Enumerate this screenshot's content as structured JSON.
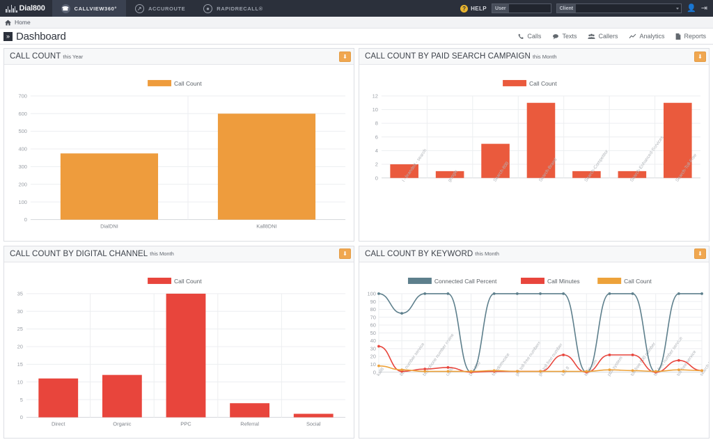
{
  "topnav": {
    "brand": "Dial800",
    "brand_sup": "®",
    "products": [
      {
        "label": "CALLVIEW360°",
        "icon": "phone-circle-icon",
        "active": true
      },
      {
        "label": "ACCUROUTE",
        "icon": "route-circle-icon",
        "active": false
      },
      {
        "label": "RAPIDRECALL®",
        "icon": "bulb-circle-icon",
        "active": false
      }
    ],
    "help_label": "HELP",
    "help_badge": "?",
    "user_field": {
      "label": "User",
      "value": "",
      "placeholder": ""
    },
    "client_field": {
      "label": "Client",
      "value": "",
      "placeholder": ""
    },
    "account_icon": "user-icon",
    "logout_icon": "logout-icon"
  },
  "breadcrumb": {
    "home": "Home",
    "icon": "home-icon"
  },
  "page": {
    "title": "Dashboard",
    "chevron": "»",
    "tabs": [
      {
        "label": "Calls",
        "icon": "phone-icon"
      },
      {
        "label": "Texts",
        "icon": "chat-icon"
      },
      {
        "label": "Callers",
        "icon": "people-icon"
      },
      {
        "label": "Analytics",
        "icon": "chart-line-icon"
      },
      {
        "label": "Reports",
        "icon": "document-icon"
      }
    ]
  },
  "colors": {
    "orange": "#ee9c3d",
    "red": "#e8453c",
    "red_orange": "#ea5a3d",
    "teal": "#5d7f8c",
    "dark": "#2b303b",
    "download": "#f0a750"
  },
  "panels": [
    {
      "title": "CALL COUNT",
      "subtitle": "this Year",
      "download_icon": "download-icon"
    },
    {
      "title": "CALL COUNT BY PAID SEARCH CAMPAIGN",
      "subtitle": "this Month",
      "download_icon": "download-icon"
    },
    {
      "title": "CALL COUNT BY DIGITAL CHANNEL",
      "subtitle": "this Month",
      "download_icon": "download-icon"
    },
    {
      "title": "CALL COUNT BY KEYWORD",
      "subtitle": "this Month",
      "download_icon": "download-icon"
    }
  ],
  "chart_data": [
    {
      "type": "bar",
      "title": "CALL COUNT this Year",
      "categories": [
        "DialDNI",
        "Kall8DNI"
      ],
      "values": [
        375,
        600
      ],
      "series": [
        {
          "name": "Call Count",
          "values": [
            375,
            600
          ],
          "color": "#ee9c3d"
        }
      ],
      "legend": [
        "Call Count"
      ],
      "legend_position": "top",
      "yticks": [
        0,
        100,
        200,
        300,
        400,
        500,
        600,
        700
      ],
      "ylim": [
        0,
        700
      ],
      "xlabel": "",
      "ylabel": "",
      "grid": true
    },
    {
      "type": "bar",
      "title": "CALL COUNT BY PAID SEARCH CAMPAIGN this Month",
      "categories": [
        "l - branded - search",
        "google",
        "Search-800",
        "Search-Brand",
        "Search-Competitor",
        "Search-Enhanced-Services",
        "Search-Toll-Free"
      ],
      "values": [
        2,
        1,
        5,
        11,
        1,
        1,
        11
      ],
      "series": [
        {
          "name": "Call Count",
          "values": [
            2,
            1,
            5,
            11,
            1,
            1,
            11
          ],
          "color": "#ea5a3d"
        }
      ],
      "legend": [
        "Call Count"
      ],
      "legend_position": "top",
      "yticks": [
        0,
        2,
        4,
        6,
        8,
        10,
        12
      ],
      "ylim": [
        0,
        12
      ],
      "xlabel": "",
      "ylabel": "",
      "grid": true
    },
    {
      "type": "bar",
      "title": "CALL COUNT BY DIGITAL CHANNEL this Month",
      "categories": [
        "Direct",
        "Organic",
        "PPC",
        "Referral",
        "Social"
      ],
      "values": [
        11,
        12,
        35,
        4,
        1
      ],
      "series": [
        {
          "name": "Call Count",
          "values": [
            11,
            12,
            35,
            4,
            1
          ],
          "color": "#e8453c"
        }
      ],
      "legend": [
        "Call Count"
      ],
      "legend_position": "top",
      "yticks": [
        0,
        5,
        10,
        15,
        20,
        25,
        30,
        35
      ],
      "ylim": [
        0,
        35
      ],
      "xlabel": "",
      "ylabel": "",
      "grid": true
    },
    {
      "type": "line",
      "title": "CALL COUNT BY KEYWORD this Month",
      "categories": [
        "kall8",
        "800 number service",
        "buy phone number online",
        "call8",
        "Dial 800",
        "freedomvoice",
        "get toll-free numbers",
        "get toll free number",
        "kall 8",
        "kall8 com",
        "pbx system",
        "toll free 800 number",
        "toll free number service",
        "toll free service",
        "search toll free numbers"
      ],
      "series": [
        {
          "name": "Connected Call Percent",
          "color": "#5d7f8c",
          "values": [
            100,
            75,
            100,
            100,
            0,
            100,
            100,
            100,
            100,
            0,
            100,
            100,
            0,
            100,
            100
          ]
        },
        {
          "name": "Call Minutes",
          "color": "#e8453c",
          "values": [
            33,
            1,
            4,
            6,
            0,
            1,
            1,
            1,
            22,
            0,
            22,
            22,
            0,
            15,
            2
          ]
        },
        {
          "name": "Call Count",
          "color": "#eda23a",
          "values": [
            8,
            3,
            1,
            1,
            1,
            2,
            1,
            1,
            1,
            1,
            3,
            2,
            1,
            3,
            2
          ]
        }
      ],
      "legend": [
        "Connected Call Percent",
        "Call Minutes",
        "Call Count"
      ],
      "legend_position": "top",
      "yticks": [
        0,
        10,
        20,
        30,
        40,
        50,
        60,
        70,
        80,
        90,
        100
      ],
      "ylim": [
        0,
        100
      ],
      "xlabel": "",
      "ylabel": "",
      "grid": true
    }
  ]
}
